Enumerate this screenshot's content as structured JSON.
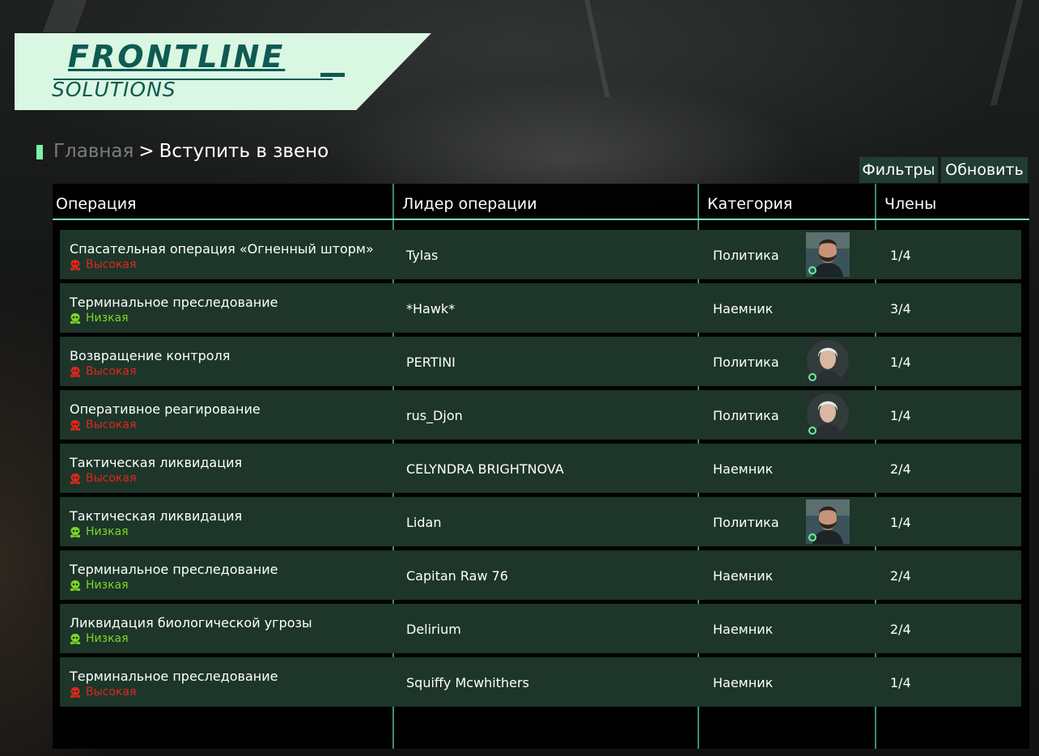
{
  "logo": {
    "line1": "FRONTLINE",
    "line2": "SOLUTIONS"
  },
  "breadcrumb": {
    "home": "Главная",
    "separator": ">",
    "current": "Вступить в звено"
  },
  "toolbar": {
    "filters_label": "Фильтры",
    "refresh_label": "Обновить"
  },
  "table": {
    "headers": {
      "operation": "Операция",
      "leader": "Лидер операции",
      "category": "Категория",
      "members": "Члены"
    },
    "rows": [
      {
        "operation": "Спасательная операция «Огненный шторм»",
        "threat": "Высокая",
        "threat_level": "high",
        "leader": "Tylas",
        "category": "Политика",
        "avatar": "bearded-man",
        "members": "1/4"
      },
      {
        "operation": "Терминальное преследование",
        "threat": "Низкая",
        "threat_level": "low",
        "leader": "*Hawk*",
        "category": "Наемник",
        "avatar": "",
        "members": "3/4"
      },
      {
        "operation": "Возвращение контроля",
        "threat": "Высокая",
        "threat_level": "high",
        "leader": "PERTINI",
        "category": "Политика",
        "avatar": "white-haired-woman",
        "members": "1/4"
      },
      {
        "operation": "Оперативное реагирование",
        "threat": "Высокая",
        "threat_level": "high",
        "leader": "rus_Djon",
        "category": "Политика",
        "avatar": "white-haired-woman",
        "members": "1/4"
      },
      {
        "operation": "Тактическая ликвидация",
        "threat": "Высокая",
        "threat_level": "high",
        "leader": "CELYNDRA BRIGHTNOVA",
        "category": "Наемник",
        "avatar": "",
        "members": "2/4"
      },
      {
        "operation": "Тактическая ликвидация",
        "threat": "Низкая",
        "threat_level": "low",
        "leader": "Lidan",
        "category": "Политика",
        "avatar": "bearded-man",
        "members": "1/4"
      },
      {
        "operation": "Терминальное преследование",
        "threat": "Низкая",
        "threat_level": "low",
        "leader": "Capitan Raw 76",
        "category": "Наемник",
        "avatar": "",
        "members": "2/4"
      },
      {
        "operation": "Ликвидация биологической угрозы",
        "threat": "Низкая",
        "threat_level": "low",
        "leader": "Delirium",
        "category": "Наемник",
        "avatar": "",
        "members": "2/4"
      },
      {
        "operation": "Терминальное преследование",
        "threat": "Высокая",
        "threat_level": "high",
        "leader": "Squiffy Mcwhithers",
        "category": "Наемник",
        "avatar": "",
        "members": "1/4"
      }
    ]
  },
  "colors": {
    "accent": "#7ef0a8",
    "row_bg": "#1d3629",
    "threat_high": "#e0261c",
    "threat_low": "#7cd62a",
    "logo_bg": "#d9f7e3",
    "logo_text": "#0f5a52"
  }
}
